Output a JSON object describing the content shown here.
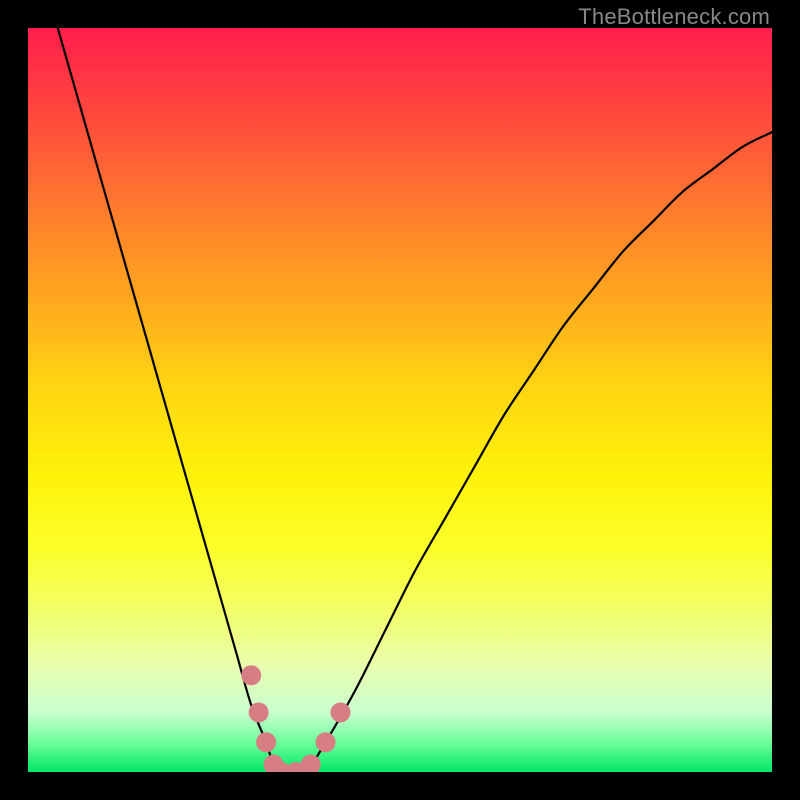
{
  "watermark": "TheBottleneck.com",
  "colors": {
    "curve": "#000000",
    "blob": "#d77d84",
    "gradient_top": "#ff1e4c",
    "gradient_bottom": "#00e765"
  },
  "chart_data": {
    "type": "line",
    "title": "",
    "xlabel": "",
    "ylabel": "",
    "xlim": [
      0,
      100
    ],
    "ylim": [
      0,
      100
    ],
    "x": [
      4,
      6,
      8,
      10,
      12,
      14,
      16,
      18,
      20,
      22,
      24,
      26,
      28,
      30,
      32,
      33,
      34,
      36,
      38,
      40,
      44,
      48,
      52,
      56,
      60,
      64,
      68,
      72,
      76,
      80,
      84,
      88,
      92,
      96,
      100
    ],
    "y": [
      100,
      93,
      86,
      79,
      72,
      65,
      58,
      51,
      44,
      37,
      30,
      23,
      16,
      9,
      4,
      1,
      0,
      0,
      1,
      4,
      11,
      19,
      27,
      34,
      41,
      48,
      54,
      60,
      65,
      70,
      74,
      78,
      81,
      84,
      86
    ],
    "blob_points": [
      {
        "x": 30,
        "y": 13
      },
      {
        "x": 31,
        "y": 8
      },
      {
        "x": 32,
        "y": 4
      },
      {
        "x": 33,
        "y": 1
      },
      {
        "x": 34,
        "y": 0
      },
      {
        "x": 36,
        "y": 0
      },
      {
        "x": 38,
        "y": 1
      },
      {
        "x": 40,
        "y": 4
      },
      {
        "x": 42,
        "y": 8
      }
    ],
    "blob_radius_px": 10
  }
}
